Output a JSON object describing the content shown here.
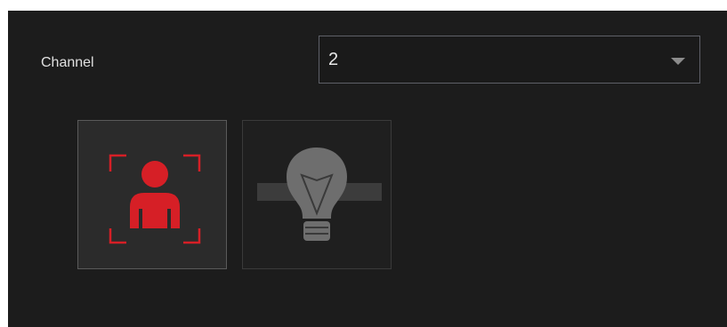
{
  "channel": {
    "label": "Channel",
    "selected_value": "2"
  },
  "modes": [
    {
      "icon": "face-detection-icon",
      "state": "selected",
      "color": "#d61f26"
    },
    {
      "icon": "light-bulb-icon",
      "state": "unselected",
      "color": "#6e6e6e"
    }
  ],
  "colors": {
    "panel_background": "#1c1c1c",
    "accent": "#d61f26",
    "border": "#5e6068"
  }
}
